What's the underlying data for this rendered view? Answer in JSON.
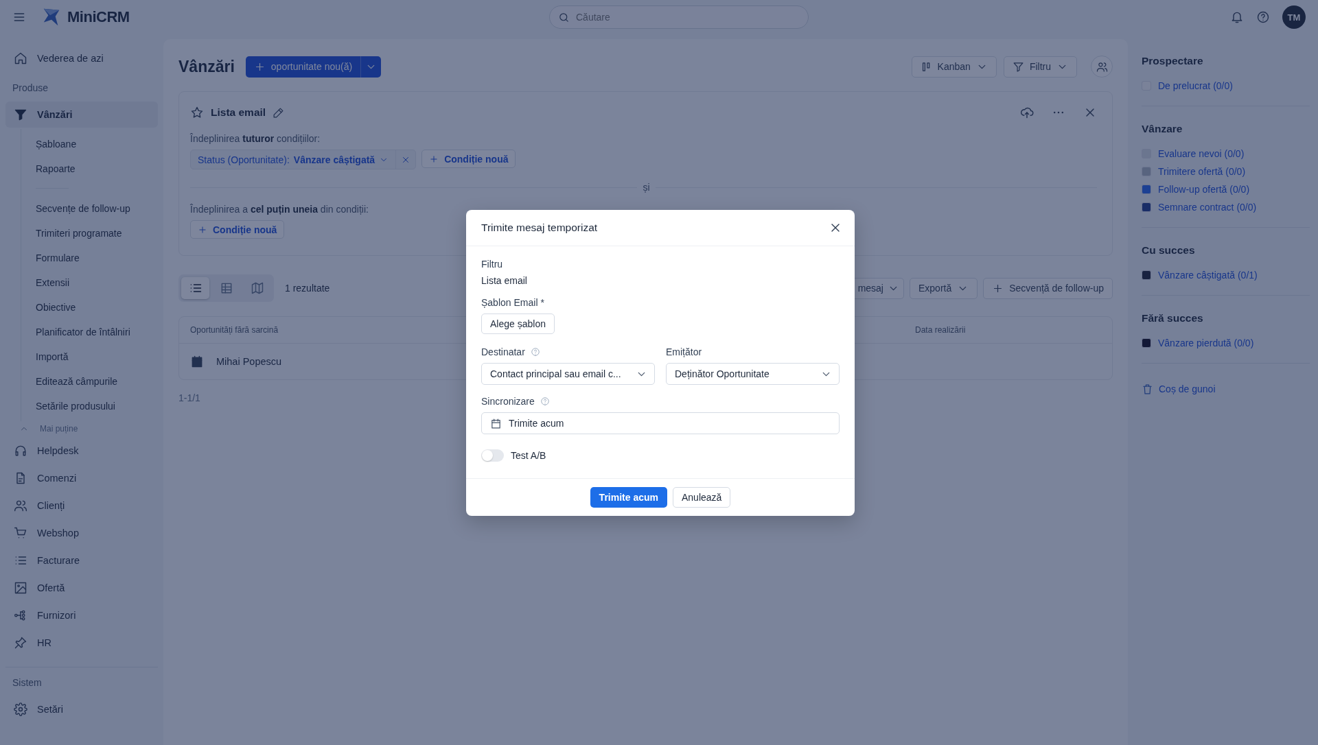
{
  "app": {
    "logo": "MiniCRM",
    "search_placeholder": "Căutare",
    "avatar": "TM"
  },
  "sidebar": {
    "items": [
      {
        "kind": "nav",
        "label": "Vederea de azi",
        "selected": false
      },
      {
        "kind": "section",
        "label": "Produse"
      },
      {
        "kind": "nav",
        "label": "Vânzări",
        "selected": true,
        "children": [
          {
            "kind": "link",
            "label": "Șabloane",
            "selected": false
          },
          {
            "kind": "link",
            "label": "Rapoarte",
            "selected": false
          },
          {
            "kind": "separator"
          },
          {
            "kind": "link",
            "label": "Secvențe de follow-up",
            "selected": false
          },
          {
            "kind": "link",
            "label": "Trimiteri programate",
            "selected": false
          },
          {
            "kind": "link",
            "label": "Formulare",
            "selected": false
          },
          {
            "kind": "link",
            "label": "Extensii",
            "selected": false
          },
          {
            "kind": "link",
            "label": "Obiective",
            "selected": false
          },
          {
            "kind": "link",
            "label": "Planificator de întâlniri",
            "selected": false
          },
          {
            "kind": "link",
            "label": "Importă",
            "selected": false
          },
          {
            "kind": "link",
            "label": "Editează câmpurile",
            "selected": false
          },
          {
            "kind": "link",
            "label": "Setările produsului",
            "selected": false
          }
        ]
      },
      {
        "kind": "collapse",
        "label": "Mai puține",
        "expanded": true
      },
      {
        "kind": "nav",
        "label": "Helpdesk",
        "selected": false
      },
      {
        "kind": "nav",
        "label": "Comenzi",
        "selected": false
      },
      {
        "kind": "nav",
        "label": "Clienți",
        "selected": false
      },
      {
        "kind": "nav",
        "label": "Webshop",
        "selected": false
      },
      {
        "kind": "nav",
        "label": "Facturare",
        "selected": false
      },
      {
        "kind": "nav",
        "label": "Ofertă",
        "selected": false
      },
      {
        "kind": "nav",
        "label": "Furnizori",
        "selected": false
      },
      {
        "kind": "nav",
        "label": "HR",
        "selected": false
      }
    ],
    "footer": [
      {
        "kind": "section",
        "label": "Sistem"
      },
      {
        "kind": "nav",
        "label": "Setări",
        "selected": false
      }
    ]
  },
  "page": {
    "title": "Vânzări",
    "new_button": "oportunitate nou(ă)",
    "view_button": "Kanban",
    "filter_button": "Filtru"
  },
  "filter": {
    "name": "Lista email",
    "all_text": "Îndeplinirea **tuturor** condițiilor:",
    "conditions": [
      {
        "field": "Status (Oportunitate):",
        "value": "Vânzare câștigată"
      }
    ],
    "add_condition": "Condiție nouă",
    "joiner": "și",
    "any_text": "Îndeplinirea a **cel puțin uneia** din condiții:",
    "any_add": "Condiție nouă"
  },
  "results": {
    "views": [
      {
        "selected": true
      },
      {
        "selected": false
      },
      {
        "selected": false
      }
    ],
    "count": "1 rezultate",
    "buttons": [
      "mesaj",
      "Exportă"
    ],
    "sequence_button": "Secvență de follow-up"
  },
  "table": {
    "columns": [
      "Oportunități fără sarcină",
      "Data realizării"
    ],
    "rows": [
      {
        "name": "Mihai Popescu"
      }
    ],
    "pagination": "1-1/1"
  },
  "stages": [
    {
      "title": "Prospectare",
      "items": [
        {
          "label": "De prelucrat (0/0)",
          "color": "#7a8299"
        }
      ]
    },
    {
      "title": "Vânzare",
      "items": [
        {
          "label": "Evaluare nevoi (0/0)",
          "color": "#6b768f"
        },
        {
          "label": "Trimitere ofertă (0/0)",
          "color": "#58647f"
        },
        {
          "label": "Follow-up ofertă (0/0)",
          "color": "#1c4093"
        },
        {
          "label": "Semnare contract (0/0)",
          "color": "#192d67"
        }
      ]
    },
    {
      "title": "Cu succes",
      "items": [
        {
          "label": "Vânzare câștigată (0/1)",
          "color": "#192341"
        }
      ]
    },
    {
      "title": "Fără succes",
      "items": [
        {
          "label": "Vânzare pierdută (0/0)",
          "color": "#131937"
        }
      ]
    }
  ],
  "trash": "Coș de gunoi",
  "modal": {
    "title": "Trimite mesaj temporizat",
    "filter_label": "Filtru",
    "filter_value": "Lista email",
    "template_label": "Șablon Email *",
    "template_button": "Alege șablon",
    "recipient_label": "Destinatar",
    "recipient_value": "Contact principal sau email c...",
    "sender_label": "Emițător",
    "sender_value": "Deținător Oportunitate",
    "sync_label": "Sincronizare",
    "sync_value": "Trimite acum",
    "ab": {
      "label": "Test A/B",
      "on": false
    },
    "submit": "Trimite acum",
    "cancel": "Anulează"
  }
}
